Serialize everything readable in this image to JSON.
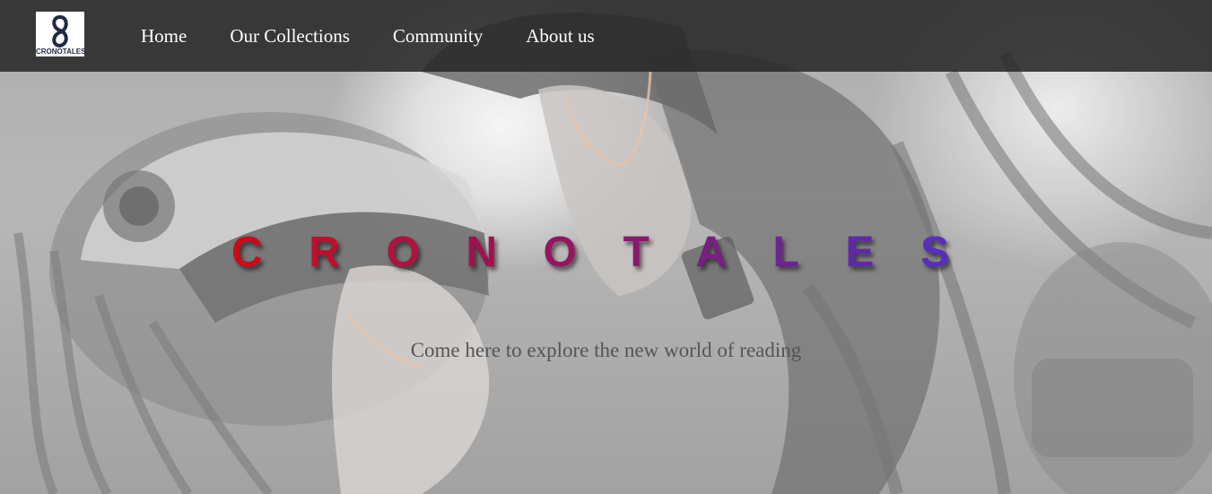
{
  "brand": {
    "logo_text": "CRONOTALES",
    "logo_color": "#1f2a44"
  },
  "nav": {
    "items": [
      {
        "label": "Home"
      },
      {
        "label": "Our Collections"
      },
      {
        "label": "Community"
      },
      {
        "label": "About us"
      }
    ]
  },
  "hero": {
    "title_letters": [
      "C",
      "R",
      "O",
      "N",
      "O",
      "T",
      "A",
      "L",
      "E",
      "S"
    ],
    "title_colors": [
      "#cc0a1a",
      "#bf0f2c",
      "#b0123e",
      "#a0124f",
      "#93165f",
      "#861a70",
      "#7a1e82",
      "#6d2394",
      "#6228a8",
      "#5a2cc0"
    ],
    "tagline": "Come here to explore the new world of reading"
  }
}
